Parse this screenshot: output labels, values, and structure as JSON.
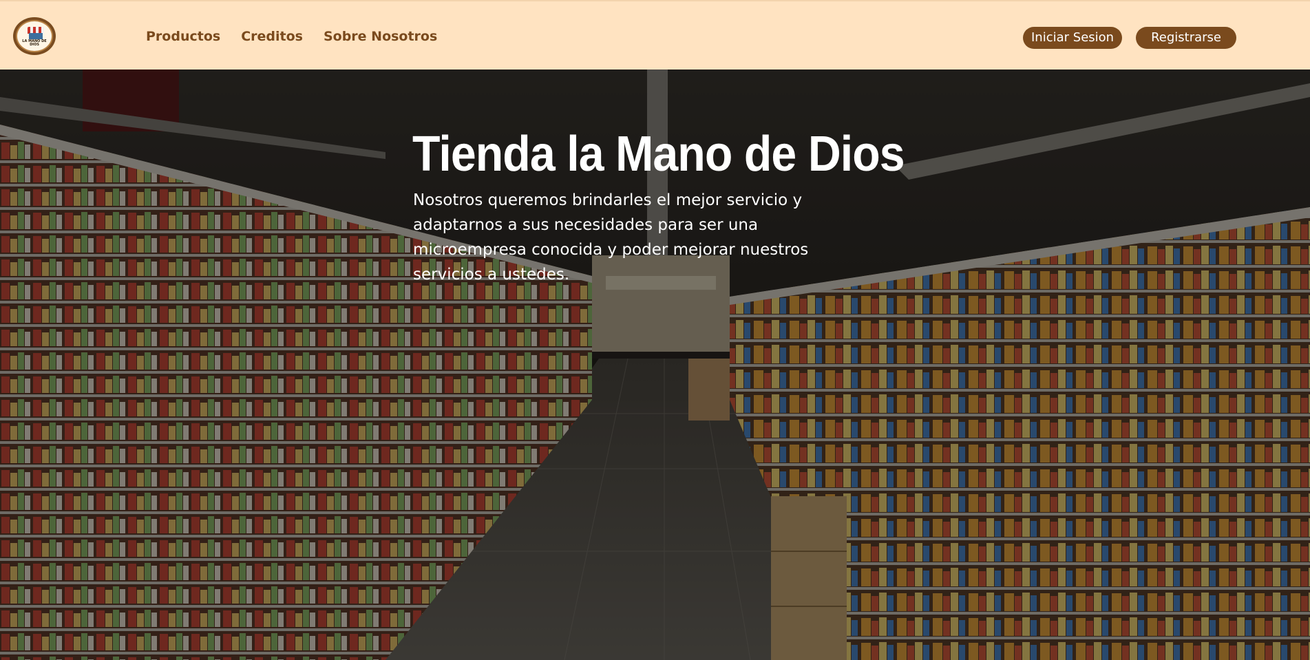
{
  "header": {
    "logo_label": "LA MANO DE DIOS",
    "nav": [
      {
        "label": "Productos"
      },
      {
        "label": "Creditos"
      },
      {
        "label": "Sobre Nosotros"
      }
    ],
    "login_label": "Iniciar Sesion",
    "register_label": "Registrarse"
  },
  "hero": {
    "title": "Tienda la Mano de Dios",
    "description": "Nosotros queremos brindarles el mejor servicio y adaptarnos a sus necesidades para ser una microempresa conocida y poder mejorar nuestros servicios a ustedes.",
    "background": "supermarket-aisle-photo"
  },
  "colors": {
    "header_bg": "#ffe3c1",
    "accent_brown": "#7a4a1d",
    "hero_text": "#ffffff"
  }
}
